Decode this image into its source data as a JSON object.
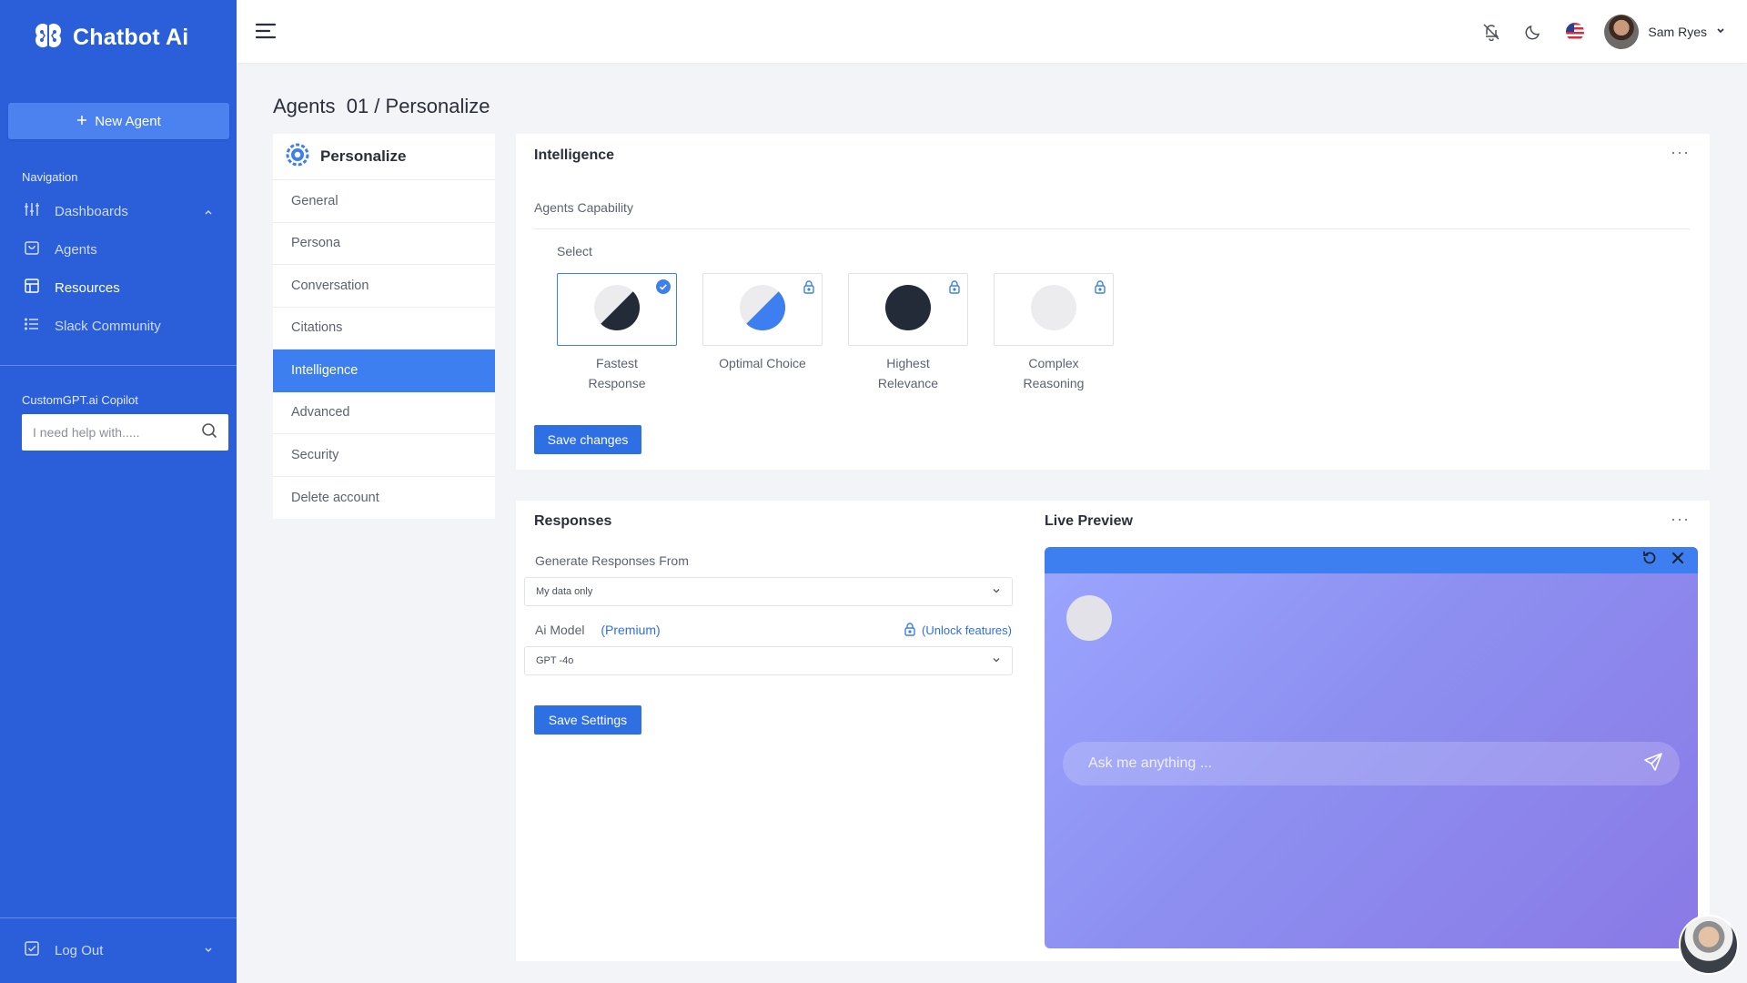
{
  "sidebar": {
    "brand": "Chatbot Ai",
    "new_agent": "New Agent",
    "nav_heading": "Navigation",
    "items": [
      {
        "label": "Dashboards"
      },
      {
        "label": "Agents"
      },
      {
        "label": "Resources"
      },
      {
        "label": "Slack Community"
      }
    ],
    "copilot_heading": "CustomGPT.ai Copilot",
    "copilot_placeholder": "I need help with.....",
    "logout": "Log Out"
  },
  "header": {
    "user_name": "Sam Ryes"
  },
  "breadcrumb": "Agents  01 / Personalize",
  "settings_menu": {
    "title": "Personalize",
    "items": [
      "General",
      "Persona",
      "Conversation",
      "Citations",
      "Intelligence",
      "Advanced",
      "Security",
      "Delete account"
    ],
    "active": "Intelligence"
  },
  "intelligence": {
    "title": "Intelligence",
    "capability_label": "Agents Capability",
    "select_label": "Select",
    "options": [
      {
        "line1": "Fastest",
        "line2": "Response",
        "selected": true
      },
      {
        "line1": "Optimal Choice",
        "line2": "",
        "selected": false
      },
      {
        "line1": "Highest",
        "line2": "Relevance",
        "selected": false
      },
      {
        "line1": "Complex",
        "line2": "Reasoning",
        "selected": false
      }
    ],
    "save_button": "Save changes"
  },
  "responses": {
    "title": "Responses",
    "generate_label": "Generate Responses From",
    "generate_value": "My data only",
    "model_label": "Ai Model",
    "premium_label": "(Premium)",
    "unlock_label": "(Unlock features)",
    "model_value": "GPT -4o",
    "save_button": "Save Settings"
  },
  "live_preview": {
    "title": "Live Preview",
    "ask_placeholder": "Ask me anything ..."
  },
  "colors": {
    "sidebar": "#2b5fd9",
    "accent": "#3d7ef0",
    "button": "#2f6fe4",
    "preview_gradient_start": "#9aa6ff",
    "preview_gradient_end": "#8a79e6"
  }
}
